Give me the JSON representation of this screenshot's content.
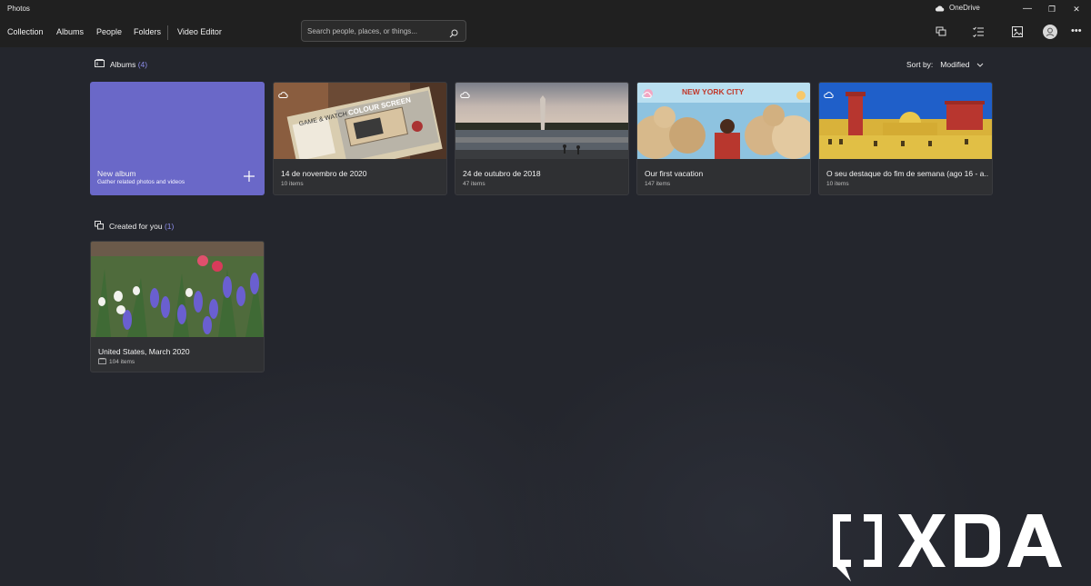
{
  "window": {
    "title": "Photos",
    "onedrive_label": "OneDrive",
    "buttons": {
      "minimize": "—",
      "restore": "❐",
      "close": "✕"
    }
  },
  "nav": {
    "tabs": [
      {
        "label": "Collection",
        "active": false
      },
      {
        "label": "Albums",
        "active": true
      },
      {
        "label": "People",
        "active": false
      },
      {
        "label": "Folders",
        "active": false
      },
      {
        "label": "Video Editor",
        "active": false
      }
    ]
  },
  "search": {
    "placeholder": "Search people, places, or things..."
  },
  "toolbar": {
    "more_label": "•••"
  },
  "albums_section": {
    "title": "Albums",
    "count": "(4)",
    "sort_label": "Sort by:",
    "sort_value": "Modified",
    "new_album": {
      "title": "New album",
      "subtitle": "Gather related photos and videos"
    },
    "items": [
      {
        "title": "14 de novembro de 2020",
        "count": "10 items"
      },
      {
        "title": "24 de outubro de 2018",
        "count": "47 items"
      },
      {
        "title": "Our first vacation",
        "count": "147 items"
      },
      {
        "title": "O seu destaque do fim de semana (ago 16 - a...",
        "count": "10 items"
      }
    ]
  },
  "created_section": {
    "title": "Created for you",
    "count": "(1)",
    "items": [
      {
        "title": "United States, March 2020",
        "count": "104 items"
      }
    ]
  },
  "image_text": {
    "colour_screen": "COLOUR SCREEN",
    "game_watch": "GAME & WATCH",
    "new_york_city": "NEW YORK CITY"
  },
  "watermark": "XDA",
  "colors": {
    "accent": "#6a68c8",
    "count": "#8d8dea",
    "background": "#24262d",
    "titlebar": "#202020"
  }
}
